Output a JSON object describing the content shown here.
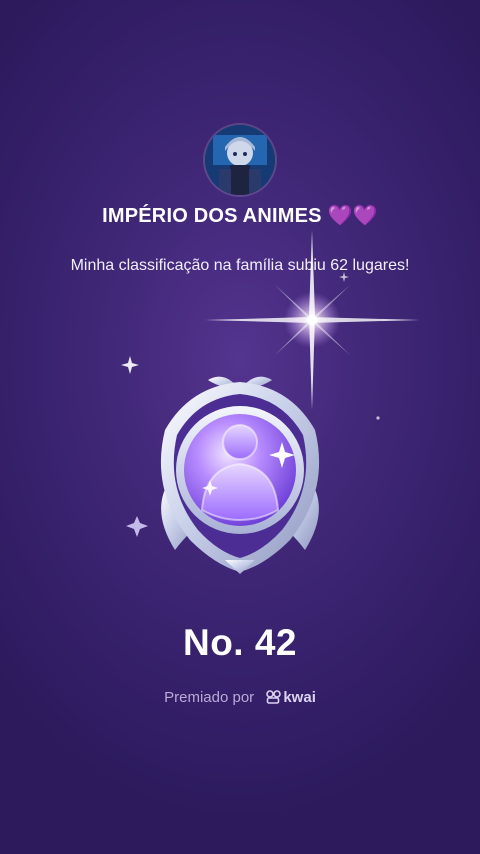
{
  "header": {
    "group_name": "IMPÉRIO DOS ANIMES",
    "hearts": "💜💜",
    "message": "Minha classificação na família subiu 62 lugares!"
  },
  "rank": {
    "label": "No. 42"
  },
  "footer": {
    "awarded_by": "Premiado por",
    "brand": "kwai",
    "brand_icon": "kwai-logo-icon"
  },
  "colors": {
    "background": "#3b236f",
    "heart": "#c24bff",
    "medal_silver": "#dfe6f6",
    "medal_purple": "#9b64ff"
  }
}
